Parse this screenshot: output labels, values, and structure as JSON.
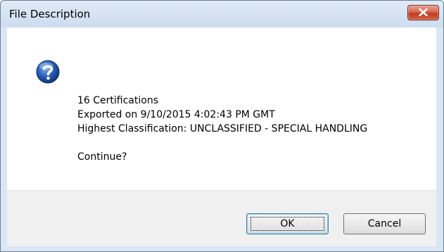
{
  "window": {
    "title": "File Description"
  },
  "icons": {
    "close": "close-icon",
    "question": "question-icon"
  },
  "message": {
    "line1": "16 Certifications",
    "line2": "Exported on 9/10/2015 4:02:43 PM GMT",
    "line3": "Highest Classification: UNCLASSIFIED - SPECIAL HANDLING",
    "prompt": "Continue?"
  },
  "buttons": {
    "ok": "OK",
    "cancel": "Cancel"
  },
  "colors": {
    "close_button": "#c7432a",
    "question_icon": "#2a5fb8"
  }
}
